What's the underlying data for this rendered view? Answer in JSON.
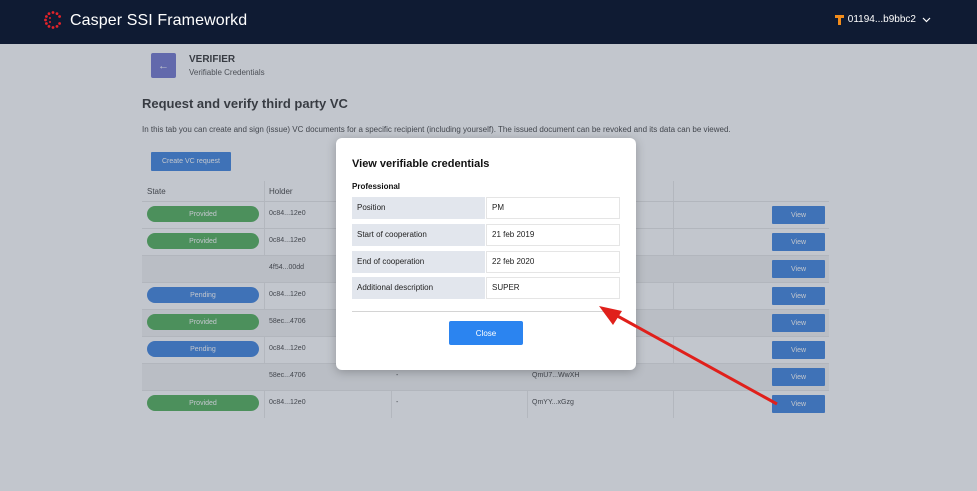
{
  "header": {
    "app_title": "Casper SSI Frameworkd",
    "account_label": "01194...b9bbc2"
  },
  "page": {
    "back_label": "←",
    "role_title": "VERIFIER",
    "role_subtitle": "Verifiable Credentials",
    "heading": "Request and verify third party VC",
    "description": "In this tab you can create and sign (issue) VC documents for a specific recipient (including yourself). The issued document can be revoked and its data can be viewed.",
    "create_button": "Create VC request"
  },
  "table": {
    "headers": {
      "state": "State",
      "holder": "Holder"
    },
    "view_label": "View",
    "rows": [
      {
        "state": "Provided",
        "holder": "0c84...12e0",
        "col3": "",
        "col4": ""
      },
      {
        "state": "Provided",
        "holder": "0c84...12e0",
        "col3": "",
        "col4": ""
      },
      {
        "state": "",
        "holder": "4f54...00dd",
        "col3": "",
        "col4": ""
      },
      {
        "state": "Pending",
        "holder": "0c84...12e0",
        "col3": "",
        "col4": ""
      },
      {
        "state": "Provided",
        "holder": "58ec...4706",
        "col3": "",
        "col4": ""
      },
      {
        "state": "Pending",
        "holder": "0c84...12e0",
        "col3": "",
        "col4": ""
      },
      {
        "state": "",
        "holder": "58ec...4706",
        "col3": "-",
        "col4": "QmU7...WwXH"
      },
      {
        "state": "Provided",
        "holder": "0c84...12e0",
        "col3": "-",
        "col4": "QmYY...xGzg"
      }
    ]
  },
  "modal": {
    "title": "View verifiable credentials",
    "section": "Professional",
    "fields": [
      {
        "label": "Position",
        "value": "PM"
      },
      {
        "label": "Start of cooperation",
        "value": "21 feb 2019"
      },
      {
        "label": "End of cooperation",
        "value": "22 feb 2020"
      },
      {
        "label": "Additional description",
        "value": "SUPER"
      }
    ],
    "close_label": "Close"
  },
  "colors": {
    "header_bg": "#0f1b33",
    "accent_blue": "#1e6fd9",
    "provided_green": "#35a33d",
    "back_purple": "#5b5fc7",
    "arrow_red": "#e0201b"
  },
  "icons": {
    "logo": "casper-logo-icon",
    "account": "account-icon",
    "chevron": "chevron-down-icon",
    "back": "arrow-left-icon"
  }
}
